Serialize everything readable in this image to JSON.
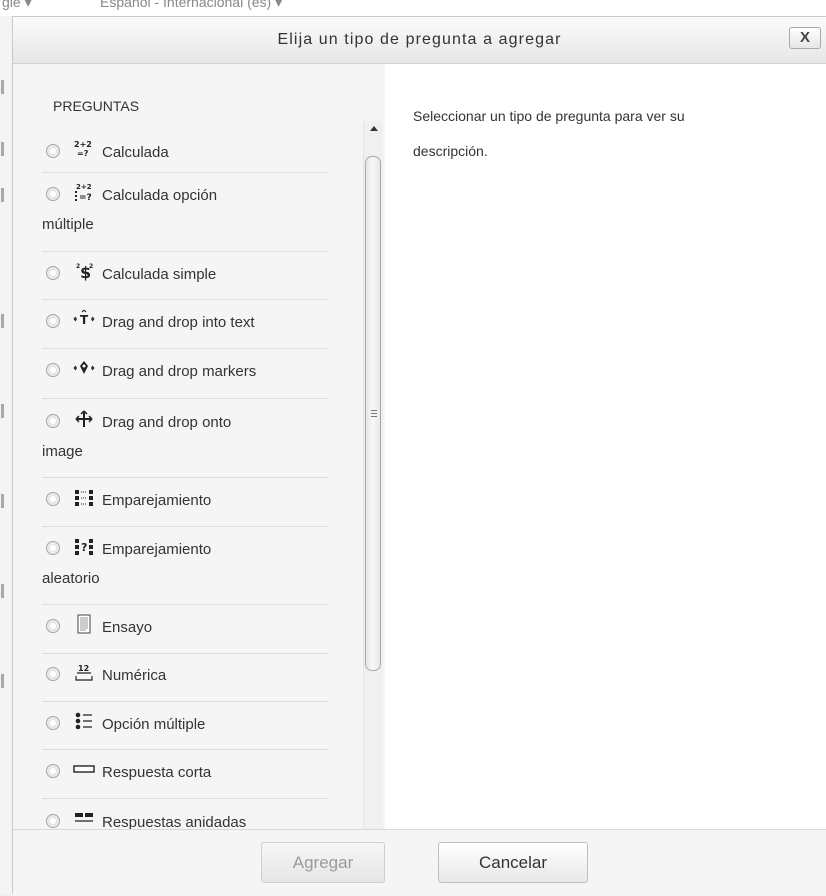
{
  "background": {
    "partial_text_left": "gle ▾",
    "partial_text_right": "Español - Internacional (es) ▾"
  },
  "dialog": {
    "title": "Elija un tipo de pregunta a agregar",
    "close_label": "X"
  },
  "options": {
    "heading": "PREGUNTAS",
    "items": [
      {
        "icon": "calculated-icon",
        "icon_glyph": "²⁺²₌?",
        "label": "Calculada",
        "label_2": ""
      },
      {
        "icon": "calculated-multichoice-icon",
        "icon_glyph": "⁼?",
        "label": "Calculada opción",
        "label_2": "múltiple"
      },
      {
        "icon": "calculated-simple-icon",
        "icon_glyph": "Ş",
        "label": "Calculada simple",
        "label_2": ""
      },
      {
        "icon": "drag-drop-text-icon",
        "icon_glyph": "‹T›",
        "label": "Drag and drop into text",
        "label_2": ""
      },
      {
        "icon": "drag-drop-markers-icon",
        "icon_glyph": "‹◆›",
        "label": "Drag and drop markers",
        "label_2": ""
      },
      {
        "icon": "drag-drop-image-icon",
        "icon_glyph": "✛",
        "label": "Drag and drop onto",
        "label_2": "image"
      },
      {
        "icon": "matching-icon",
        "icon_glyph": "⁝≡⁝",
        "label": "Emparejamiento",
        "label_2": ""
      },
      {
        "icon": "random-matching-icon",
        "icon_glyph": "⁝?⁝",
        "label": "Emparejamiento",
        "label_2": "aleatorio"
      },
      {
        "icon": "essay-icon",
        "icon_glyph": "▤",
        "label": "Ensayo",
        "label_2": ""
      },
      {
        "icon": "numerical-icon",
        "icon_glyph": "¹²",
        "label": "Numérica",
        "label_2": ""
      },
      {
        "icon": "multichoice-icon",
        "icon_glyph": "⁝☰",
        "label": "Opción múltiple",
        "label_2": ""
      },
      {
        "icon": "short-answer-icon",
        "icon_glyph": "▭",
        "label": "Respuesta corta",
        "label_2": ""
      },
      {
        "icon": "embedded-answers-icon",
        "icon_glyph": "▀▀",
        "label": "Respuestas anidadas",
        "label_2": ""
      }
    ]
  },
  "description": {
    "line1": "Seleccionar un tipo de pregunta para ver su",
    "line2": "descripción."
  },
  "footer": {
    "add_label": "Agregar",
    "cancel_label": "Cancelar"
  }
}
